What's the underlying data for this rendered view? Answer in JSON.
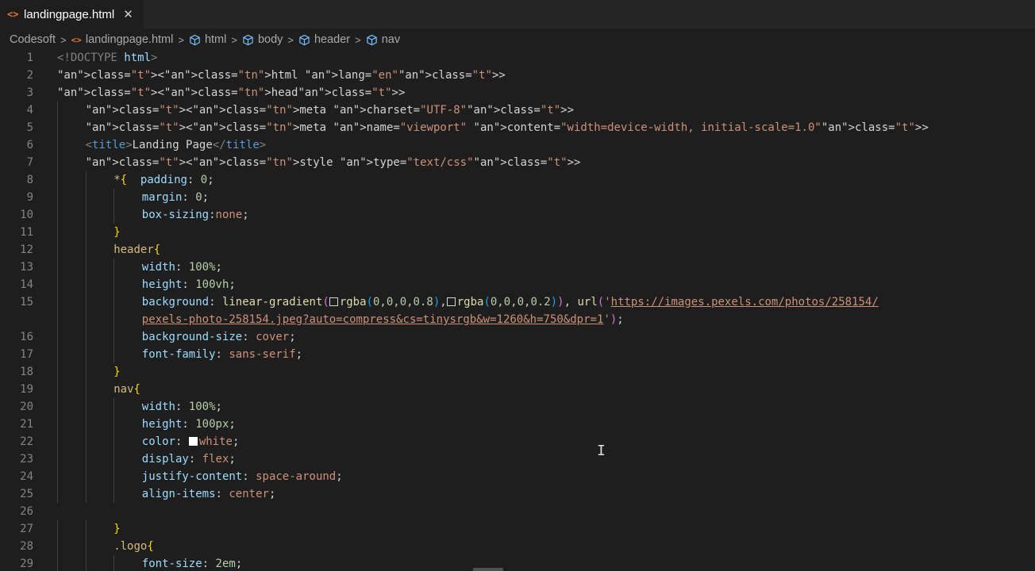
{
  "tab": {
    "icon": "html-file-icon",
    "label": "landingpage.html",
    "close": "✕"
  },
  "breadcrumb": {
    "items": [
      {
        "label": "Codesoft",
        "icon": ""
      },
      {
        "label": "landingpage.html",
        "icon": "html-file-icon"
      },
      {
        "label": "html",
        "icon": "symbol-element-icon"
      },
      {
        "label": "body",
        "icon": "symbol-element-icon"
      },
      {
        "label": "header",
        "icon": "symbol-element-icon"
      },
      {
        "label": "nav",
        "icon": "symbol-element-icon"
      }
    ],
    "separator": ">"
  },
  "editor": {
    "line_numbers": [
      "1",
      "2",
      "3",
      "4",
      "5",
      "6",
      "7",
      "8",
      "9",
      "10",
      "11",
      "12",
      "13",
      "14",
      "15",
      "",
      "16",
      "17",
      "18",
      "19",
      "20",
      "21",
      "22",
      "23",
      "24",
      "25",
      "26",
      "27",
      "28",
      "29"
    ],
    "lines": [
      "<!DOCTYPE html>",
      "<html lang=\"en\">",
      "<head>",
      "    <meta charset=\"UTF-8\">",
      "    <meta name=\"viewport\" content=\"width=device-width, initial-scale=1.0\">",
      "    <title>Landing Page</title>",
      "    <style type=\"text/css\">",
      "        *{  padding: 0;",
      "            margin: 0;",
      "            box-sizing:none;",
      "        }",
      "        header{",
      "            width: 100%;",
      "            height: 100vh;",
      "            background: linear-gradient(rgba(0,0,0,0.8),rgba(0,0,0,0.2)), url('https://images.pexels.com/photos/258154/",
      "            pexels-photo-258154.jpeg?auto=compress&cs=tinysrgb&w=1260&h=750&dpr=1');",
      "            background-size: cover;",
      "            font-family: sans-serif;",
      "        }",
      "        nav{",
      "            width: 100%;",
      "            height: 100px;",
      "            color: white;",
      "            display: flex;",
      "            justify-content: space-around;",
      "            align-items: center;",
      "",
      "        }",
      "        .logo{",
      "            font-size: 2em;"
    ]
  },
  "colors": {
    "background": "#1e1e1e",
    "tab_bar": "#252526",
    "line_number": "#858585",
    "file_icon": "#e37933"
  }
}
